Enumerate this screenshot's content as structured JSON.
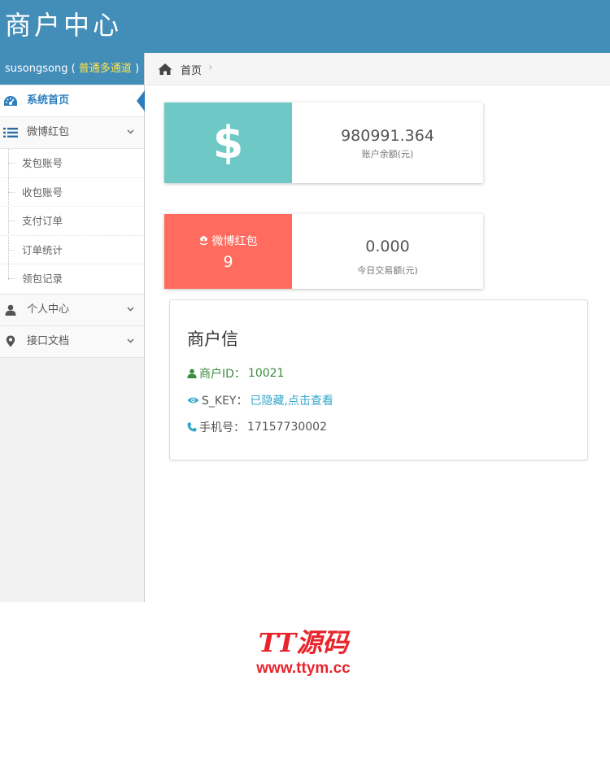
{
  "header": {
    "title": "商户中心",
    "color": "#438eb9"
  },
  "user": {
    "name": "susongsong",
    "open": " ( ",
    "plan": "普通多通道",
    "close": " )"
  },
  "sidebar": {
    "items": [
      {
        "label": "系统首页",
        "icon": "dashboard-icon",
        "active": true
      },
      {
        "label": "微博红包",
        "icon": "list-icon",
        "expanded": true,
        "children": [
          {
            "label": "发包账号"
          },
          {
            "label": "收包账号"
          },
          {
            "label": "支付订单"
          },
          {
            "label": "订单统计"
          },
          {
            "label": "领包记录"
          }
        ]
      },
      {
        "label": "个人中心",
        "icon": "user-icon"
      },
      {
        "label": "接口文档",
        "icon": "map-marker-icon"
      }
    ]
  },
  "breadcrumb": {
    "home": "首页",
    "separator": "›"
  },
  "balance_card": {
    "symbol": "$",
    "value": "980991.364",
    "caption": "账户余额(元)",
    "color": "#6ec8c5"
  },
  "weibo_card": {
    "title": "微博红包",
    "count": "9",
    "value": "0.000",
    "caption": "今日交易额(元)",
    "color": "#ff6c5f"
  },
  "merchant_info": {
    "title": "商户信",
    "id_label": "商户ID：",
    "id_value": "10021",
    "skey_label": "S_KEY：",
    "skey_value": "已隐藏,点击查看",
    "phone_label": "手机号：",
    "phone_value": "17157730002"
  },
  "watermark": {
    "logo": "TT源码",
    "url": "www.ttym.cc"
  }
}
